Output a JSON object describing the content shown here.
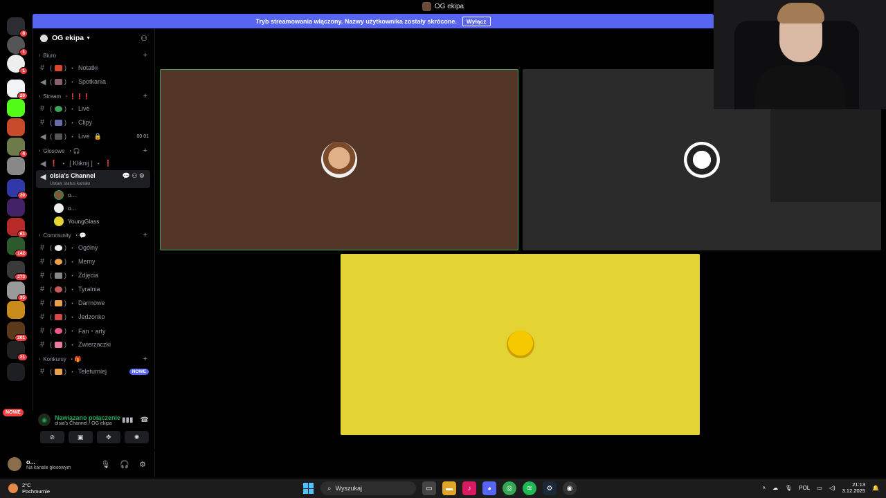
{
  "window": {
    "title": "OG ekipa"
  },
  "banner": {
    "text": "Tryb streamowania włączony. Nazwy użytkownika zostały skrócone.",
    "button": "Wyłącz"
  },
  "rail": {
    "badges": [
      "8",
      "1",
      "1",
      "20",
      "4",
      "20",
      "61",
      "142",
      "273",
      "35",
      "201",
      "21"
    ],
    "nowe": "NOWE"
  },
  "guild": {
    "name": "OG ekipa"
  },
  "categories": {
    "biuro": "Biuro",
    "stream": "Stream",
    "glosowe": "Głosowe",
    "community": "Community",
    "konkursy": "Konkursy"
  },
  "channels": {
    "notatki": "Notatki",
    "spotkania": "Spotkania",
    "live_text": "Live",
    "clipy": "Clipy",
    "live_voice": "Live",
    "live_count_a": "00",
    "live_count_b": "01",
    "kliknij": "[ Kliknij ]",
    "olsia": "olsia's Channel",
    "olsia_status": "Ustaw status kanału",
    "ogolny": "Ogólny",
    "memy": "Memy",
    "zdjecia": "Zdjęcia",
    "tyralnia": "Tyralnia",
    "darmowe": "Darmowe",
    "jedzonko": "Jedzonko",
    "fan_arty": "Fan・arty",
    "zwierzaczki": "Zwierzaczki",
    "teleturniej": "Teleturniej",
    "teleturniej_badge": "NOWE"
  },
  "voice_users": [
    "o...",
    "o...",
    "YoungGlass"
  ],
  "voice_panel": {
    "status": "Nawiązano połączenie",
    "channel": "olsia's Channel / OG ekipa"
  },
  "user_panel": {
    "name": "o...",
    "status": "Na kanale głosowym"
  },
  "taskbar": {
    "weather_temp": "2°C",
    "weather_desc": "Pochmurnie",
    "search": "Wyszukaj",
    "lang": "POL",
    "time": "21:13",
    "date": "3.12.2025"
  },
  "colors": {
    "accent": "#5865f2",
    "connected": "#23a55a",
    "tile1": "#533527",
    "tile2": "#2b2b2c",
    "tile3": "#e3d434"
  }
}
